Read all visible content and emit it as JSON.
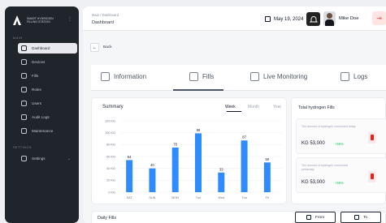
{
  "sidebar": {
    "brand_line1": "SMART HYDROGEN",
    "brand_line2": "FILLING STATION",
    "main_section": "MAIN",
    "settings_section": "SETTINGS",
    "items": [
      {
        "label": "Dashboard",
        "active": true
      },
      {
        "label": "Devices",
        "active": false
      },
      {
        "label": "Fills",
        "active": false
      },
      {
        "label": "Roles",
        "active": false
      },
      {
        "label": "Users",
        "active": false
      },
      {
        "label": "Audit Logs",
        "active": false
      },
      {
        "label": "Maintenance",
        "active": false
      }
    ],
    "settings_item": "Settings"
  },
  "topbar": {
    "breadcrumb": "Main / Dashboard",
    "title": "Dashboard",
    "date": "May 19, 2024",
    "username": "Mike Doe"
  },
  "back_label": "Back",
  "tabs": [
    {
      "label": "Information",
      "active": false
    },
    {
      "label": "Fills",
      "active": true
    },
    {
      "label": "Live Monitoring",
      "active": false
    },
    {
      "label": "Logs",
      "active": false
    }
  ],
  "summary": {
    "title": "Summary",
    "periods": [
      "Week",
      "Month",
      "Year"
    ],
    "active_period": "Week"
  },
  "chart_data": {
    "type": "bar",
    "categories": [
      "SAT",
      "SUN",
      "MON",
      "Tue",
      "Wed",
      "Thu",
      "Fri"
    ],
    "values": [
      54,
      40,
      75,
      99,
      33,
      87,
      50
    ],
    "yticks": [
      "0 KG",
      "20 KG",
      "40 KG",
      "60 KG",
      "80 KG",
      "100 KG",
      "120 KG"
    ],
    "ylim": [
      0,
      120
    ],
    "bar_color": "#2f8cff"
  },
  "hydrogen": {
    "title": "Total hydrogen Fills",
    "cards": [
      {
        "label": "The amount of hydrogen consumed today",
        "value": "KG 53,000",
        "delta": "+55%"
      },
      {
        "label": "The amount of hydrogen consumed yesterday",
        "value": "KG 53,000",
        "delta": "+55%"
      }
    ]
  },
  "daily": {
    "title": "Daily Fills",
    "from_label": "From",
    "to_label": "To"
  }
}
